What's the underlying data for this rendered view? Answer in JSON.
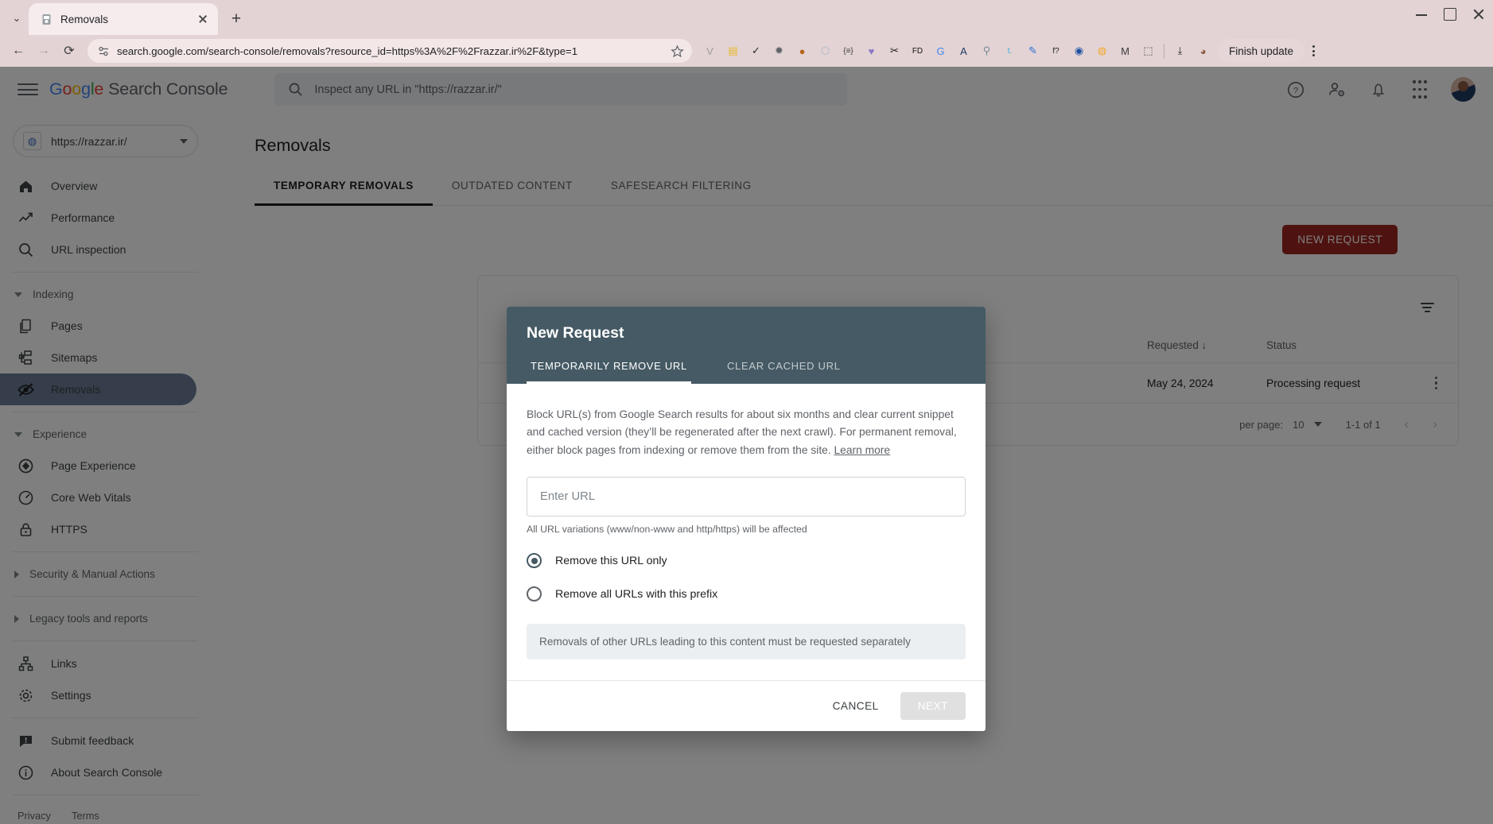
{
  "browser": {
    "tab": {
      "title": "Removals",
      "favicon": "removals-favicon"
    },
    "new_tab_label": "+",
    "address": "search.google.com/search-console/removals?resource_id=https%3A%2F%2Frazzar.ir%2F&type=1",
    "finish_update_label": "Finish update",
    "extensions": [
      {
        "name": "v-extension-icon",
        "glyph": "V",
        "color": "#9e9e9e"
      },
      {
        "name": "wallet-extension-icon",
        "glyph": "▤",
        "color": "#e8b923"
      },
      {
        "name": "check-circle-extension-icon",
        "glyph": "✓",
        "color": "#2b2b2b"
      },
      {
        "name": "bug-extension-icon",
        "glyph": "✹",
        "color": "#5f6368"
      },
      {
        "name": "cookie-extension-icon",
        "glyph": "●",
        "color": "#b5651d"
      },
      {
        "name": "shield-extension-icon",
        "glyph": "⬡",
        "color": "#aab6c6"
      },
      {
        "name": "braces-extension-icon",
        "glyph": "{≡}",
        "color": "#3c3c3c"
      },
      {
        "name": "heart-extension-icon",
        "glyph": "♥",
        "color": "#8b7ac4"
      },
      {
        "name": "tool-extension-icon",
        "glyph": "✂",
        "color": "#1a1a1a"
      },
      {
        "name": "fd-extension-icon",
        "glyph": "FD",
        "color": "#111111"
      },
      {
        "name": "google-translate-extension-icon",
        "glyph": "G",
        "color": "#4285F4"
      },
      {
        "name": "bird-extension-icon",
        "glyph": "A",
        "color": "#1f3a63"
      },
      {
        "name": "magnifier-extension-icon",
        "glyph": "⚲",
        "color": "#7a8b99"
      },
      {
        "name": "tumblr-extension-icon",
        "glyph": "t.",
        "color": "#36a9e0"
      },
      {
        "name": "pen-extension-icon",
        "glyph": "✎",
        "color": "#2f6fd0"
      },
      {
        "name": "font-extension-icon",
        "glyph": "f?",
        "color": "#222222"
      },
      {
        "name": "globe-extension-icon",
        "glyph": "◉",
        "color": "#1b4fa0"
      },
      {
        "name": "orange-extension-icon",
        "glyph": "◍",
        "color": "#f5a623"
      },
      {
        "name": "mailtrack-extension-icon",
        "glyph": "M",
        "color": "#3c3c3c"
      },
      {
        "name": "puzzle-extensions-icon",
        "glyph": "⬚",
        "color": "#3c3c3c"
      },
      {
        "name": "downloads-icon",
        "glyph": "⤓",
        "color": "#2b2b2b"
      },
      {
        "name": "profile-avatar-icon",
        "glyph": "◕",
        "color": "#8a5a44"
      }
    ]
  },
  "gsc": {
    "product_logo": {
      "g": "G",
      "o1": "o",
      "o2": "o",
      "g2": "g",
      "l": "l",
      "e": "e",
      "suffix": "Search Console"
    },
    "inspect_placeholder": "Inspect any URL in \"https://razzar.ir/\"",
    "header_icons": [
      {
        "name": "help-icon",
        "glyph": "?"
      },
      {
        "name": "user-settings-icon",
        "glyph": "person-gear"
      },
      {
        "name": "notifications-bell-icon",
        "glyph": "bell"
      },
      {
        "name": "google-apps-grid-icon",
        "glyph": "grid"
      },
      {
        "name": "account-avatar",
        "glyph": "avatar"
      }
    ],
    "property": {
      "label": "https://razzar.ir/",
      "icon": "globe-icon"
    },
    "sidebar": [
      {
        "kind": "item",
        "name": "sidebar-item-overview",
        "label": "Overview",
        "icon": "home-icon",
        "active": false
      },
      {
        "kind": "item",
        "name": "sidebar-item-performance",
        "label": "Performance",
        "icon": "trending-up-icon",
        "active": false
      },
      {
        "kind": "item",
        "name": "sidebar-item-url-inspection",
        "label": "URL inspection",
        "icon": "search-icon",
        "active": false
      },
      {
        "kind": "divider"
      },
      {
        "kind": "section",
        "name": "sidebar-section-indexing",
        "label": "Indexing",
        "expanded": true
      },
      {
        "kind": "item",
        "name": "sidebar-item-pages",
        "label": "Pages",
        "icon": "pages-icon",
        "active": false
      },
      {
        "kind": "item",
        "name": "sidebar-item-sitemaps",
        "label": "Sitemaps",
        "icon": "sitemap-icon",
        "active": false
      },
      {
        "kind": "item",
        "name": "sidebar-item-removals",
        "label": "Removals",
        "icon": "eye-off-icon",
        "active": true
      },
      {
        "kind": "divider"
      },
      {
        "kind": "section",
        "name": "sidebar-section-experience",
        "label": "Experience",
        "expanded": true
      },
      {
        "kind": "item",
        "name": "sidebar-item-page-experience",
        "label": "Page Experience",
        "icon": "page-experience-icon",
        "active": false
      },
      {
        "kind": "item",
        "name": "sidebar-item-core-web-vitals",
        "label": "Core Web Vitals",
        "icon": "gauge-icon",
        "active": false
      },
      {
        "kind": "item",
        "name": "sidebar-item-https",
        "label": "HTTPS",
        "icon": "lock-icon",
        "active": false
      },
      {
        "kind": "divider"
      },
      {
        "kind": "section",
        "name": "sidebar-section-security",
        "label": "Security & Manual Actions",
        "expanded": false
      },
      {
        "kind": "divider"
      },
      {
        "kind": "section",
        "name": "sidebar-section-legacy",
        "label": "Legacy tools and reports",
        "expanded": false
      },
      {
        "kind": "divider"
      },
      {
        "kind": "item",
        "name": "sidebar-item-links",
        "label": "Links",
        "icon": "links-icon",
        "active": false
      },
      {
        "kind": "item",
        "name": "sidebar-item-settings",
        "label": "Settings",
        "icon": "gear-icon",
        "active": false
      },
      {
        "kind": "divider"
      },
      {
        "kind": "item",
        "name": "sidebar-item-submit-feedback",
        "label": "Submit feedback",
        "icon": "feedback-icon",
        "active": false
      },
      {
        "kind": "item",
        "name": "sidebar-item-about",
        "label": "About Search Console",
        "icon": "info-icon",
        "active": false
      },
      {
        "kind": "divider"
      }
    ],
    "footer": {
      "privacy": "Privacy",
      "terms": "Terms"
    }
  },
  "main": {
    "page_title": "Removals",
    "tabs": [
      {
        "name": "tab-temporary-removals",
        "label": "TEMPORARY REMOVALS",
        "active": true
      },
      {
        "name": "tab-outdated-content",
        "label": "OUTDATED CONTENT",
        "active": false
      },
      {
        "name": "tab-safesearch-filtering",
        "label": "SAFESEARCH FILTERING",
        "active": false
      }
    ],
    "new_request_label": "NEW REQUEST",
    "table": {
      "columns": [
        "Requested",
        "Status"
      ],
      "rows": [
        {
          "requested": "May 24, 2024",
          "status": "Processing request"
        }
      ]
    },
    "pager": {
      "rows_label": "per page:",
      "rows_value": "10",
      "range": "1-1 of 1",
      "prev": "‹",
      "next": "›"
    }
  },
  "modal": {
    "title": "New Request",
    "tabs": [
      {
        "name": "modal-tab-temporarily-remove-url",
        "label": "TEMPORARILY REMOVE URL",
        "active": true
      },
      {
        "name": "modal-tab-clear-cached-url",
        "label": "CLEAR CACHED URL",
        "active": false
      }
    ],
    "description": "Block URL(s) from Google Search results for about six months and clear current snippet and cached version (they’ll be regenerated after the next crawl). For permanent removal, either block pages from indexing or remove them from the site. ",
    "learn_more": "Learn more",
    "url_input": {
      "placeholder": "Enter URL",
      "value": ""
    },
    "url_note": "All URL variations (www/non-www and http/https) will be affected",
    "radios": [
      {
        "name": "radio-remove-this-url-only",
        "label": "Remove this URL only",
        "selected": true
      },
      {
        "name": "radio-remove-all-urls-prefix",
        "label": "Remove all URLs with this prefix",
        "selected": false
      }
    ],
    "info": "Removals of other URLs leading to this content must be requested separately",
    "cancel_label": "CANCEL",
    "next_label": "NEXT",
    "accent_color": "#455a64"
  }
}
